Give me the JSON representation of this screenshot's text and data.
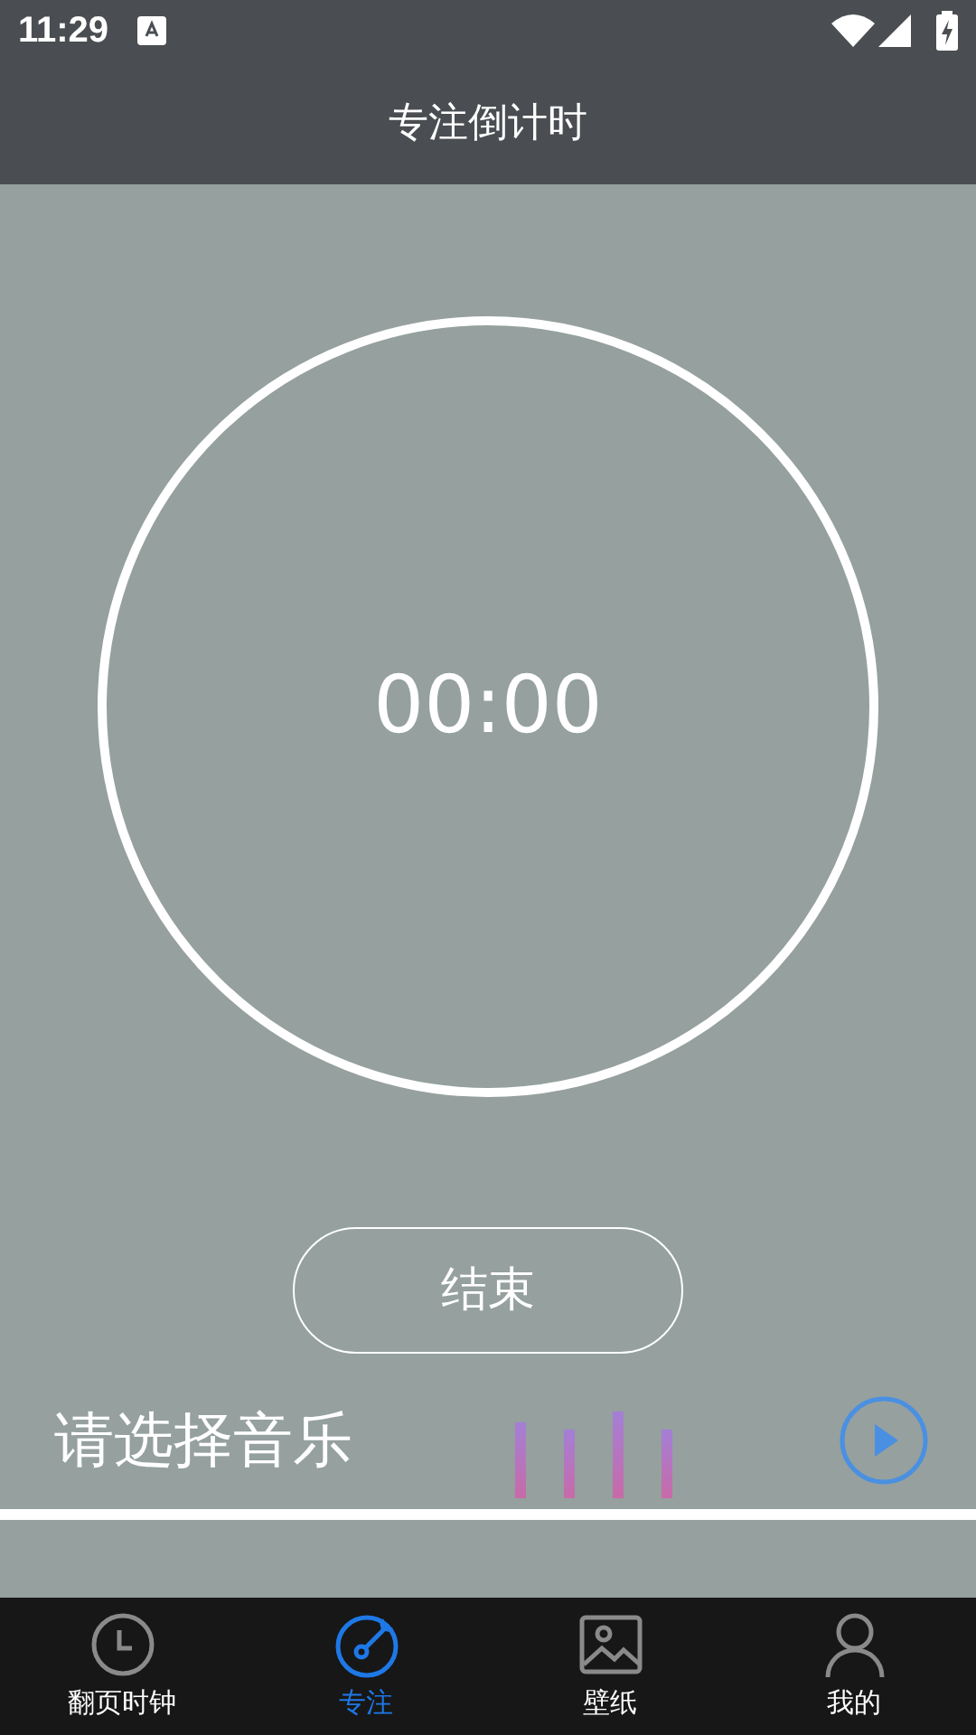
{
  "status_bar": {
    "time": "11:29"
  },
  "header": {
    "title": "专注倒计时"
  },
  "timer": {
    "display": "00:00"
  },
  "end_button": {
    "label": "结束"
  },
  "music": {
    "label": "请选择音乐"
  },
  "nav": [
    {
      "label": "翻页时钟",
      "kind": "clock",
      "selected": false
    },
    {
      "label": "专注",
      "kind": "focus",
      "selected": true
    },
    {
      "label": "壁纸",
      "kind": "wallpaper",
      "selected": false
    },
    {
      "label": "我的",
      "kind": "profile",
      "selected": false
    }
  ]
}
